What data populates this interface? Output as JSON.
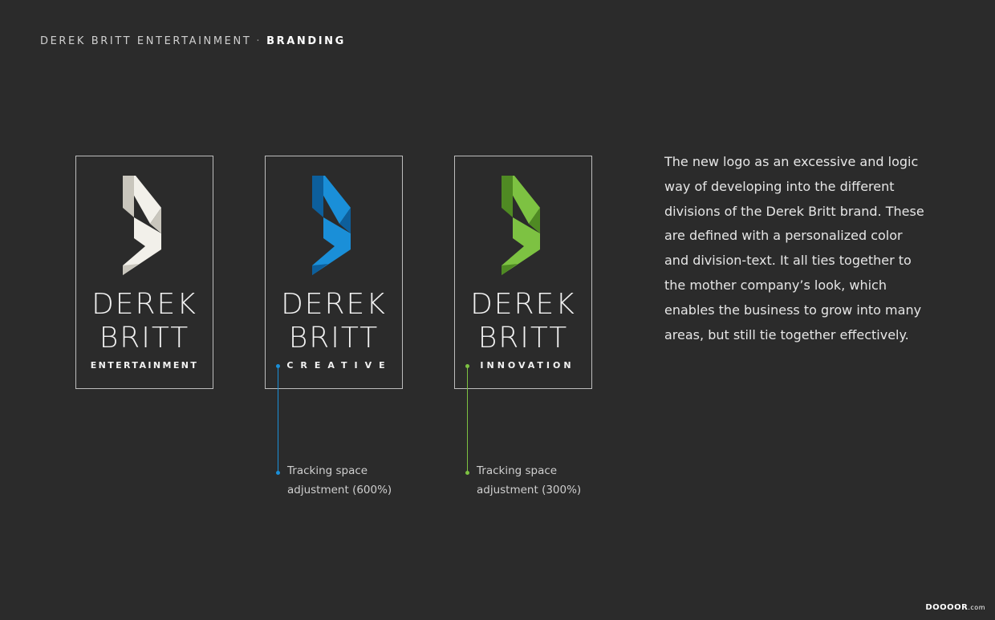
{
  "header": {
    "part1": "DEREK BRITT ENTERTAINMENT",
    "separator": "·",
    "part2": "BRANDING"
  },
  "cards": [
    {
      "line1": "DEREK",
      "line2": "BRITT",
      "division": "ENTERTAINMENT",
      "color": "#f2f0ea",
      "shade": "#c9c6bd"
    },
    {
      "line1": "DEREK",
      "line2": "BRITT",
      "division": "CREATIVE",
      "color": "#1a8fd8",
      "shade": "#0d5f9c"
    },
    {
      "line1": "DEREK",
      "line2": "BRITT",
      "division": "INNOVATION",
      "color": "#7dc242",
      "shade": "#4f8a23"
    }
  ],
  "notes": [
    {
      "line1": "Tracking space",
      "line2": "adjustment (600%)",
      "color": "#1a8fd8"
    },
    {
      "line1": "Tracking space",
      "line2": "adjustment (300%)",
      "color": "#7dc242"
    }
  ],
  "description": "The new logo as an excessive and logic way of developing into the different divisions of the Derek Britt brand. These are defined with a personalized color and division-text. It all ties together to the mother company’s look, which enables the business to grow into many areas, but still tie together effectively.",
  "watermark": {
    "main": "DOOOOR",
    "suffix": ".com"
  }
}
